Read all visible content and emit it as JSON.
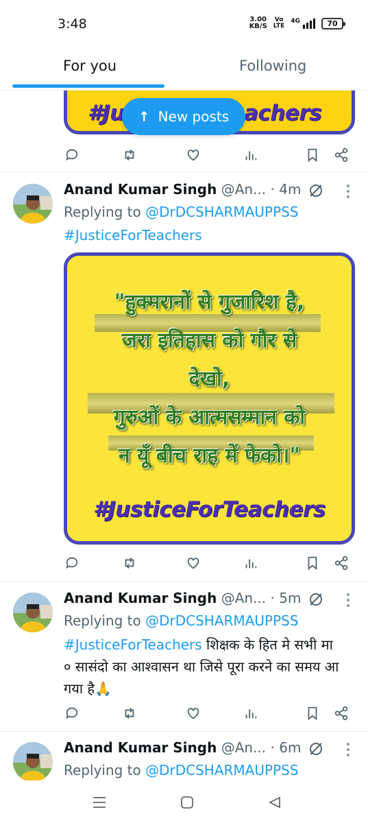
{
  "status_bar": {
    "time": "3:48",
    "speed_value": "3.00",
    "speed_unit": "KB/S",
    "network_top": "Vo",
    "network_bottom": "LTE",
    "signal_label": "4G",
    "battery": "70"
  },
  "tabs": [
    {
      "label": "For you",
      "active": true
    },
    {
      "label": "Following",
      "active": false
    }
  ],
  "new_posts_label": "New posts",
  "top_banner": {
    "hashtag_left": "#Ju",
    "hashtag_right": "achers"
  },
  "posts": [
    {
      "name": "Anand Kumar Singh",
      "handle": "@An...",
      "time": "4m",
      "replying_prefix": "Replying to",
      "replying_to": "@DrDCSHARMAUPPSS",
      "hashtag": "#JusticeForTeachers",
      "image_text": {
        "lines": [
          "\"हुक्मरानों से गुजारिश है,",
          "जरा इतिहास को गौर से",
          "देखो,",
          "गुरुओं के आत्मसम्मान को",
          "न यूँ बीच राह में फेको।\""
        ],
        "hashtag": "#JusticeForTeachers"
      }
    },
    {
      "name": "Anand Kumar Singh",
      "handle": "@An...",
      "time": "5m",
      "replying_prefix": "Replying to",
      "replying_to": "@DrDCSHARMAUPPSS",
      "hashtag": "#JusticeForTeachers",
      "text_line1": " शिक्षक के हित मे सभी मा",
      "text_line2": "० सासंदो का आश्वासन था जिसे पूरा करने का समय आ",
      "text_line3": "गया है🙏"
    },
    {
      "name": "Anand Kumar Singh",
      "handle": "@An...",
      "time": "6m",
      "replying_prefix": "Replying to",
      "replying_to": "@DrDCSHARMAUPPSS"
    }
  ],
  "colors": {
    "accent": "#1d9bf0",
    "banner_yellow": "#fcd310",
    "banner_border": "#4848b8",
    "hashtag_purple": "#4b2fb0",
    "poem_green": "#2e7d1e"
  },
  "icons": [
    "reply-icon",
    "repost-icon",
    "like-icon",
    "views-icon",
    "bookmark-icon",
    "share-icon",
    "grok-icon",
    "more-icon"
  ]
}
